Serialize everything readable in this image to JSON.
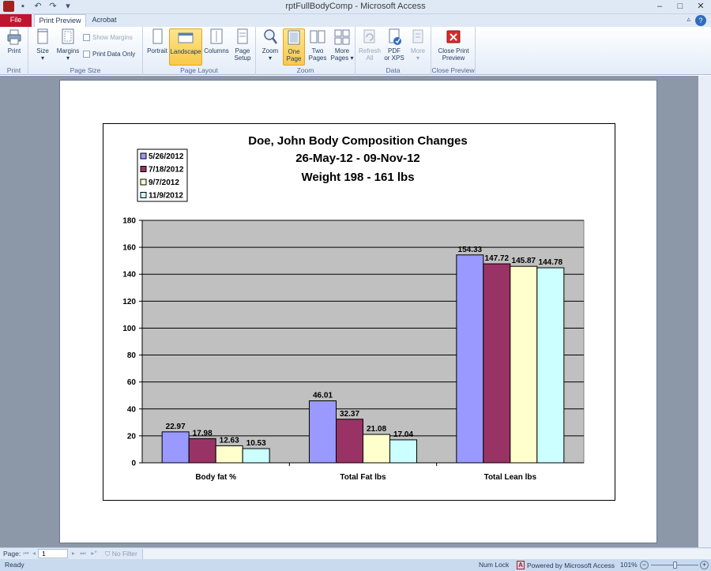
{
  "window": {
    "title": "rptFullBodyComp  -  Microsoft Access",
    "controls": {
      "minimize": "–",
      "maximize": "□",
      "close": "✕"
    }
  },
  "tabs": [
    {
      "label": "File"
    },
    {
      "label": "Print Preview"
    },
    {
      "label": "Acrobat"
    }
  ],
  "ribbon": {
    "print": {
      "button": "Print",
      "group": "Print"
    },
    "page_size": {
      "group": "Page Size",
      "size": "Size",
      "margins": "Margins",
      "show_margins": "Show Margins",
      "print_data_only": "Print Data Only"
    },
    "page_layout": {
      "group": "Page Layout",
      "portrait": "Portrait",
      "landscape": "Landscape",
      "columns": "Columns",
      "page_setup_1": "Page",
      "page_setup_2": "Setup"
    },
    "zoom": {
      "group": "Zoom",
      "zoom": "Zoom",
      "one_page_1": "One",
      "one_page_2": "Page",
      "two_pages_1": "Two",
      "two_pages_2": "Pages",
      "more_pages_1": "More",
      "more_pages_2": "Pages"
    },
    "data": {
      "group": "Data",
      "refresh_1": "Refresh",
      "refresh_2": "All",
      "pdf_1": "PDF",
      "pdf_2": "or XPS",
      "more": "More"
    },
    "close_preview": {
      "group": "Close Preview",
      "button_1": "Close Print",
      "button_2": "Preview"
    }
  },
  "navbar": {
    "page_label": "Page:",
    "page_value": "1",
    "filter": "No Filter"
  },
  "statusbar": {
    "ready": "Ready",
    "num_lock": "Num Lock",
    "powered_by": "Powered by Microsoft Access",
    "zoom": "101%"
  },
  "chart_data": {
    "type": "bar",
    "title_lines": [
      "Doe, John Body Composition Changes",
      "26-May-12  -  09-Nov-12",
      "Weight 198  -  161  lbs"
    ],
    "categories": [
      "Body fat %",
      "Total Fat lbs",
      "Total Lean lbs"
    ],
    "series": [
      {
        "name": "5/26/2012",
        "color": "#9999ff",
        "values": [
          22.97,
          46.01,
          154.33
        ]
      },
      {
        "name": "7/18/2012",
        "color": "#993366",
        "values": [
          17.98,
          32.37,
          147.72
        ]
      },
      {
        "name": "9/7/2012",
        "color": "#ffffcc",
        "values": [
          12.63,
          21.08,
          145.87
        ]
      },
      {
        "name": "11/9/2012",
        "color": "#ccffff",
        "values": [
          10.53,
          17.04,
          144.78
        ]
      }
    ],
    "ylim": [
      0,
      180
    ],
    "yticks": [
      0,
      20,
      40,
      60,
      80,
      100,
      120,
      140,
      160,
      180
    ],
    "plot_background": "#c0c0c0",
    "grid": true,
    "legend": "top-left"
  }
}
